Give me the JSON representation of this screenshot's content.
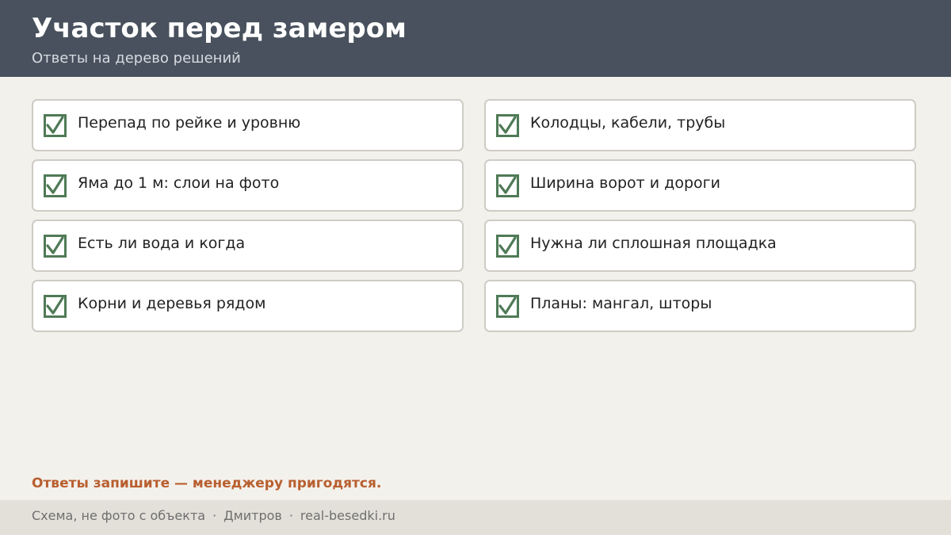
{
  "header": {
    "title": "Участок перед замером",
    "subtitle": "Ответы на дерево решений"
  },
  "checklist": [
    {
      "label": "Перепад по рейке и уровню",
      "checked": true
    },
    {
      "label": "Колодцы, кабели, трубы",
      "checked": true
    },
    {
      "label": "Яма до 1 м: слои на фото",
      "checked": true
    },
    {
      "label": "Ширина ворот и дороги",
      "checked": true
    },
    {
      "label": "Есть ли вода и когда",
      "checked": true
    },
    {
      "label": "Нужна ли сплошная площадка",
      "checked": true
    },
    {
      "label": "Корни и деревья рядом",
      "checked": true
    },
    {
      "label": "Планы: мангал, шторы",
      "checked": true
    }
  ],
  "note": "Ответы запишите — менеджеру пригодятся.",
  "footer": {
    "disclaimer": "Схема, не фото с объекта",
    "separator": "·",
    "city": "Дмитров",
    "site": "real-besedki.ru"
  },
  "colors": {
    "header_bg": "#48515d",
    "page_bg": "#f3f1ec",
    "check_green": "#4f7a56",
    "accent_orange": "#b85f2f"
  },
  "icons": {
    "check": "checkmark-box-icon"
  }
}
